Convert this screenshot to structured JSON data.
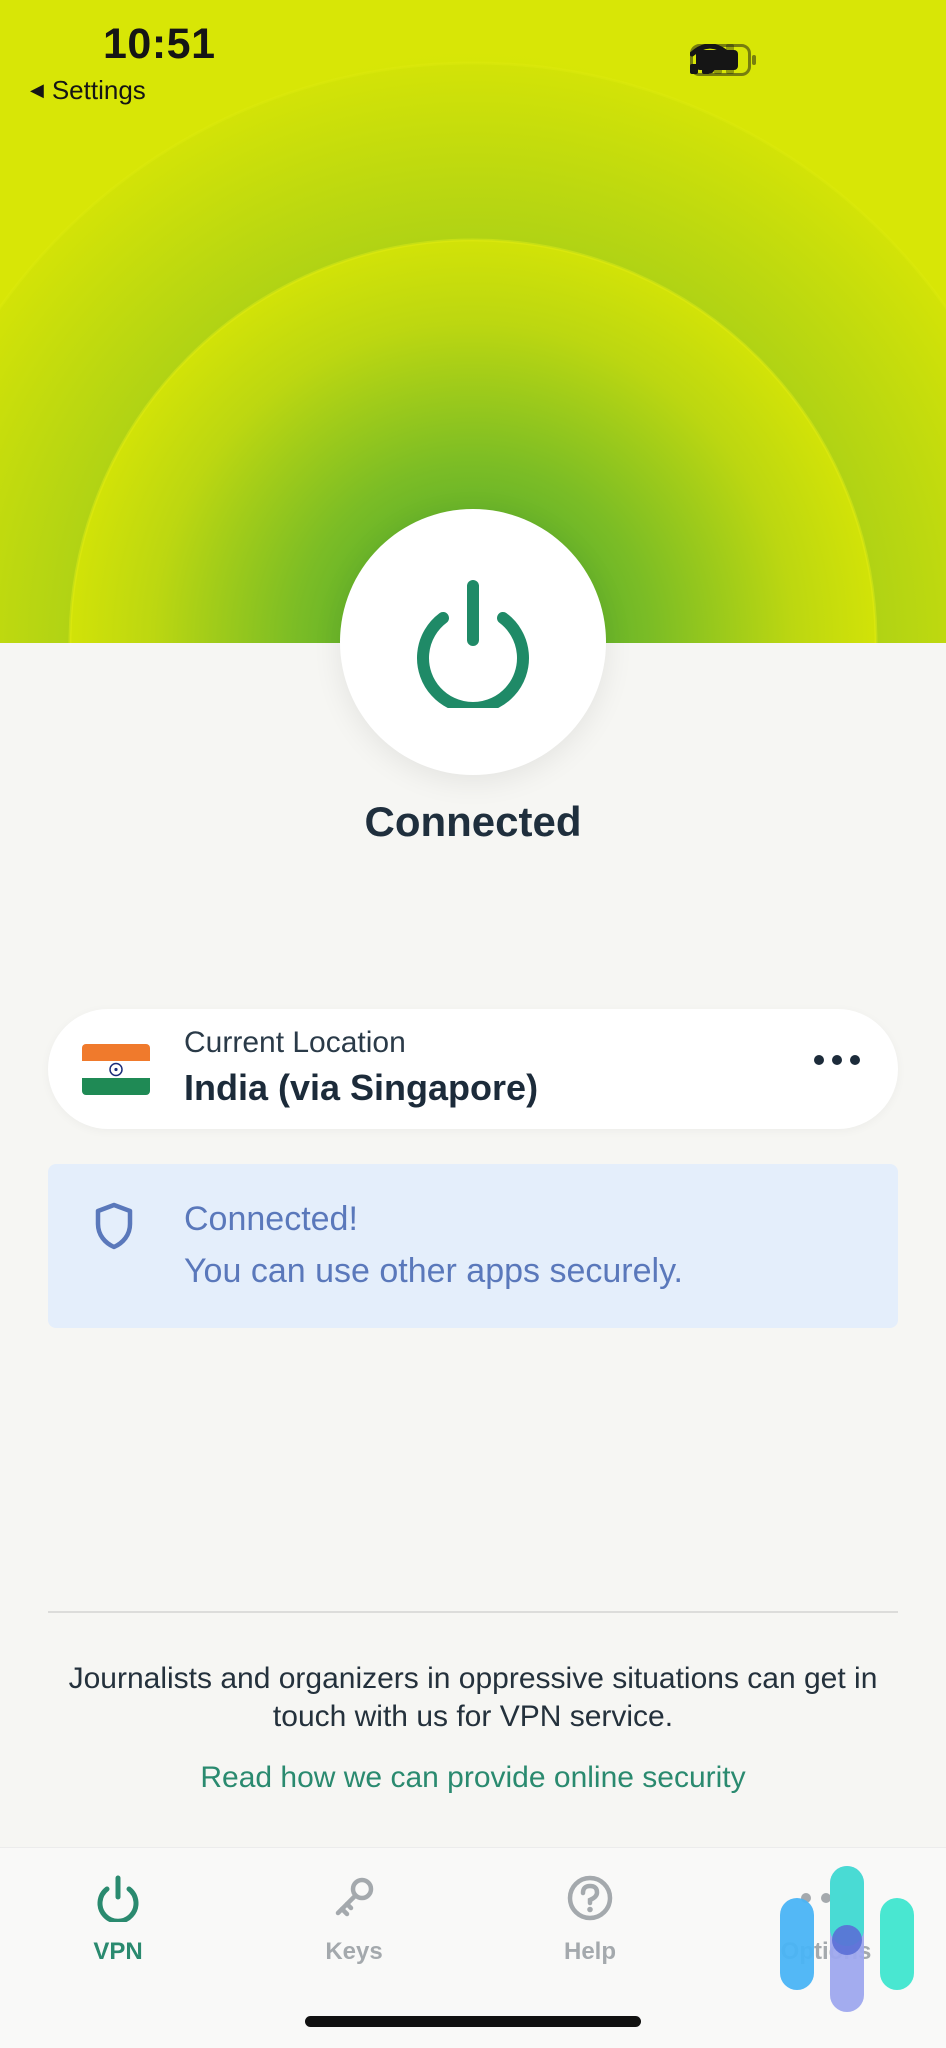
{
  "status_bar": {
    "time": "10:51",
    "back_label": "Settings",
    "icons": [
      "cellular-signal-icon",
      "wifi-icon",
      "battery-icon"
    ]
  },
  "connection": {
    "status_title": "Connected",
    "power_icon": "power-icon",
    "accent_color": "#1f8a67"
  },
  "location": {
    "label": "Current Location",
    "value": "India (via Singapore)",
    "flag": "india-flag-icon",
    "more_icon": "ellipsis-icon"
  },
  "banner": {
    "icon": "shield-icon",
    "line1": "Connected!",
    "line2": "You can use other apps securely.",
    "background": "#e4eefb",
    "text_color": "#5a78bb"
  },
  "footer": {
    "text": "Journalists and organizers in oppressive situations can get in touch with us for VPN service.",
    "link": "Read how we can provide online security"
  },
  "tabs": [
    {
      "label": "VPN",
      "icon": "power-icon",
      "active": true
    },
    {
      "label": "Keys",
      "icon": "key-icon",
      "active": false
    },
    {
      "label": "Help",
      "icon": "help-circle-icon",
      "active": false
    },
    {
      "label": "Options",
      "icon": "dots-icon",
      "active": false
    }
  ],
  "colors": {
    "hero_yellow": "#d8e606",
    "hero_green": "#3fa335",
    "link_green": "#2a8a6f",
    "page_bg": "#f6f6f3"
  }
}
